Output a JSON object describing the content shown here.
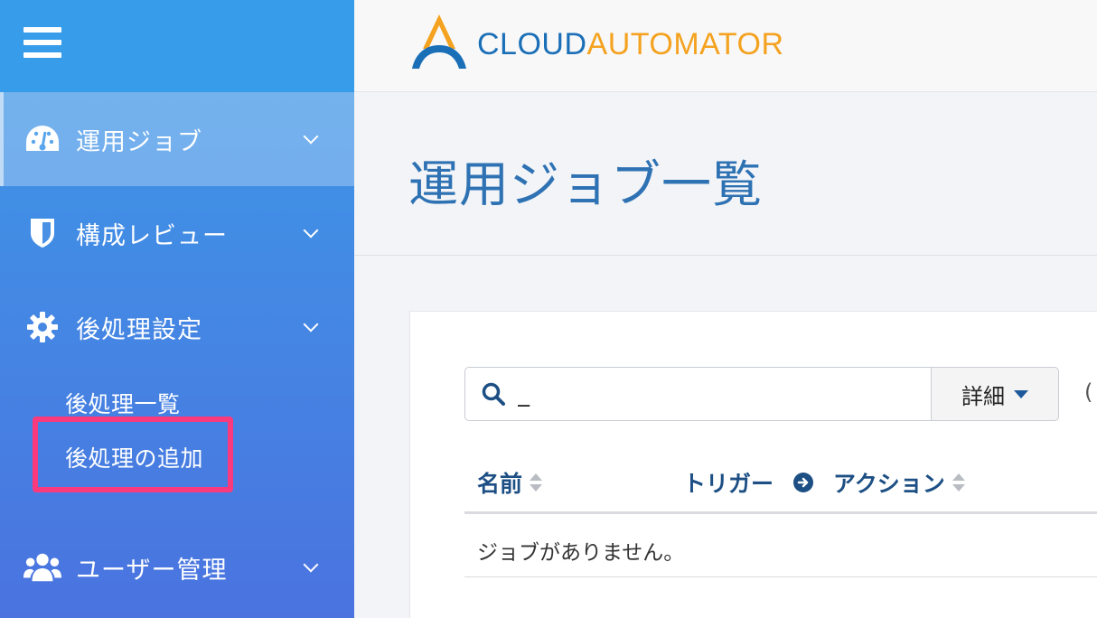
{
  "sidebar": {
    "items": [
      {
        "label": "運用ジョブ",
        "icon": "dashboard-icon",
        "active": true
      },
      {
        "label": "構成レビュー",
        "icon": "shield-icon",
        "active": false
      },
      {
        "label": "後処理設定",
        "icon": "gear-icon",
        "active": false,
        "children": [
          {
            "label": "後処理一覧"
          },
          {
            "label": "後処理の追加",
            "highlighted": true
          }
        ]
      },
      {
        "label": "ユーザー管理",
        "icon": "users-icon",
        "active": false
      }
    ]
  },
  "header": {
    "logo_text_primary": "CLOUD",
    "logo_text_secondary": "AUTOMATOR"
  },
  "page": {
    "title": "運用ジョブ一覧"
  },
  "search": {
    "value": "_",
    "detail_label": "詳細",
    "trailing_text": "("
  },
  "table": {
    "columns": [
      "名前",
      "トリガー",
      "アクション"
    ],
    "empty_message": "ジョブがありません。"
  },
  "colors": {
    "sidebar_top": "#3a9be8",
    "sidebar_bottom": "#4a73df",
    "highlight": "#fa3a7d",
    "title_blue": "#2e72b4",
    "logo_blue": "#1a6fb7",
    "logo_orange": "#f4a21f"
  }
}
